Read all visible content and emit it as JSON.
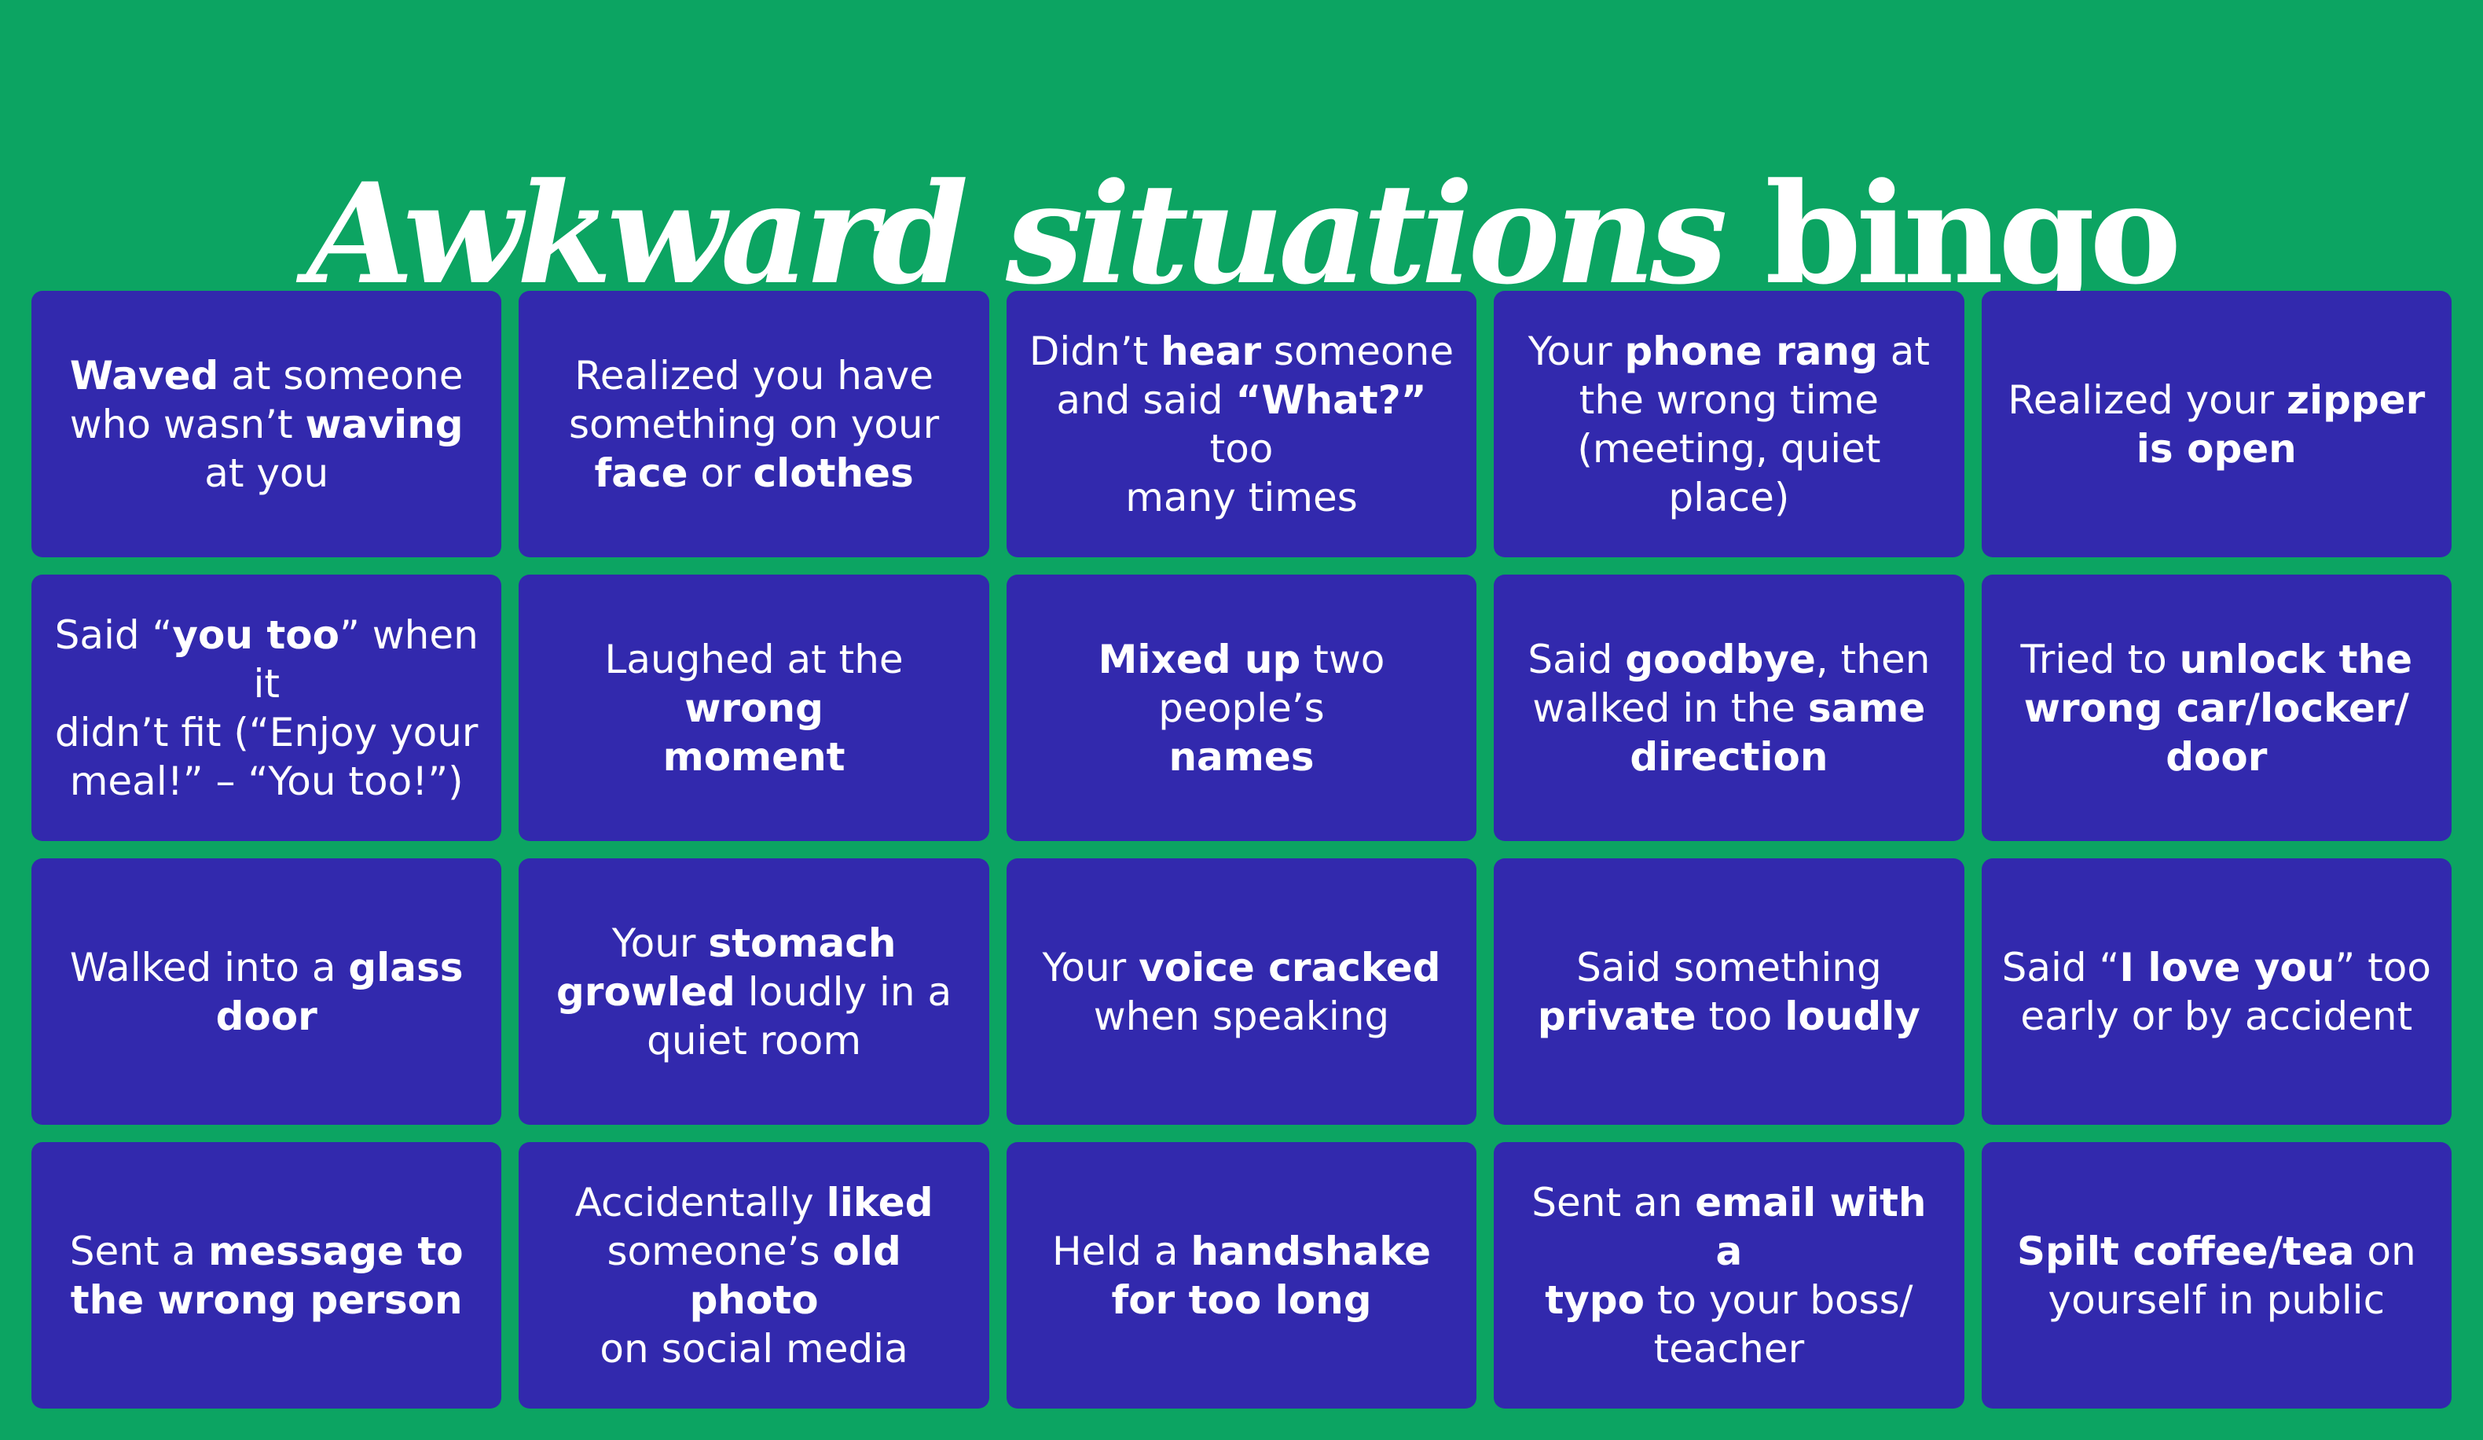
{
  "title": {
    "italic": "Awkward situations",
    "normal": "bingo"
  },
  "colors": {
    "background": "#0ca462",
    "tile": "#3229ad",
    "text": "#ffffff"
  },
  "tiles": [
    [
      [
        {
          "t": "Waved",
          "b": true
        },
        {
          "t": " at someone "
        },
        {
          "br": true
        },
        {
          "t": "who wasn’t "
        },
        {
          "t": "waving",
          "b": true
        },
        {
          "br": true
        },
        {
          "t": "at you"
        }
      ],
      [
        {
          "t": "Realized you have "
        },
        {
          "br": true
        },
        {
          "t": "something on your "
        },
        {
          "br": true
        },
        {
          "t": "face",
          "b": true
        },
        {
          "t": " or "
        },
        {
          "t": "clothes",
          "b": true
        }
      ],
      [
        {
          "t": "Didn’t "
        },
        {
          "t": "hear",
          "b": true
        },
        {
          "t": " someone "
        },
        {
          "br": true
        },
        {
          "t": "and said "
        },
        {
          "t": "“What?”",
          "b": true
        },
        {
          "t": " too "
        },
        {
          "br": true
        },
        {
          "t": "many times"
        }
      ],
      [
        {
          "t": "Your "
        },
        {
          "t": "phone rang",
          "b": true
        },
        {
          "t": " at "
        },
        {
          "br": true
        },
        {
          "t": "the wrong time "
        },
        {
          "br": true
        },
        {
          "t": "(meeting, quiet place)"
        }
      ],
      [
        {
          "t": "Realized your "
        },
        {
          "t": "zipper",
          "b": true
        },
        {
          "br": true
        },
        {
          "t": "is open",
          "b": true
        }
      ]
    ],
    [
      [
        {
          "t": "Said “"
        },
        {
          "t": "you too",
          "b": true
        },
        {
          "t": "” when it "
        },
        {
          "br": true
        },
        {
          "t": "didn’t fit (“Enjoy your "
        },
        {
          "br": true
        },
        {
          "t": "meal!” – “You too!”)"
        }
      ],
      [
        {
          "t": "Laughed at the "
        },
        {
          "t": "wrong",
          "b": true
        },
        {
          "br": true
        },
        {
          "t": "moment",
          "b": true
        }
      ],
      [
        {
          "t": "Mixed up",
          "b": true
        },
        {
          "t": " two people’s "
        },
        {
          "br": true
        },
        {
          "t": "names",
          "b": true
        }
      ],
      [
        {
          "t": "Said "
        },
        {
          "t": "goodbye",
          "b": true
        },
        {
          "t": ", then "
        },
        {
          "br": true
        },
        {
          "t": "walked in the "
        },
        {
          "t": "same",
          "b": true
        },
        {
          "br": true
        },
        {
          "t": "direction",
          "b": true
        }
      ],
      [
        {
          "t": "Tried to "
        },
        {
          "t": "unlock the",
          "b": true
        },
        {
          "br": true
        },
        {
          "t": "wrong car/locker/",
          "b": true
        },
        {
          "br": true
        },
        {
          "t": "door",
          "b": true
        }
      ]
    ],
    [
      [
        {
          "t": "Walked into a "
        },
        {
          "t": "glass",
          "b": true
        },
        {
          "br": true
        },
        {
          "t": "door",
          "b": true
        }
      ],
      [
        {
          "t": "Your "
        },
        {
          "t": "stomach",
          "b": true
        },
        {
          "br": true
        },
        {
          "t": "growled",
          "b": true
        },
        {
          "t": " loudly in a "
        },
        {
          "br": true
        },
        {
          "t": "quiet room"
        }
      ],
      [
        {
          "t": "Your "
        },
        {
          "t": "voice cracked",
          "b": true
        },
        {
          "br": true
        },
        {
          "t": "when speaking"
        }
      ],
      [
        {
          "t": "Said something "
        },
        {
          "br": true
        },
        {
          "t": "private",
          "b": true
        },
        {
          "t": " too "
        },
        {
          "t": "loudly",
          "b": true
        }
      ],
      [
        {
          "t": "Said “"
        },
        {
          "t": "I love you",
          "b": true
        },
        {
          "t": "” too "
        },
        {
          "br": true
        },
        {
          "t": "early or by accident"
        }
      ]
    ],
    [
      [
        {
          "t": "Sent a "
        },
        {
          "t": "message to",
          "b": true
        },
        {
          "br": true
        },
        {
          "t": "the wrong person",
          "b": true
        }
      ],
      [
        {
          "t": "Accidentally "
        },
        {
          "t": "liked",
          "b": true
        },
        {
          "br": true
        },
        {
          "t": "someone’s "
        },
        {
          "t": "old photo",
          "b": true
        },
        {
          "br": true
        },
        {
          "t": "on social media"
        }
      ],
      [
        {
          "t": "Held a "
        },
        {
          "t": "handshake",
          "b": true
        },
        {
          "br": true
        },
        {
          "t": "for too long",
          "b": true
        }
      ],
      [
        {
          "t": "Sent an "
        },
        {
          "t": "email with a",
          "b": true
        },
        {
          "br": true
        },
        {
          "t": "typo",
          "b": true
        },
        {
          "t": " to your boss/"
        },
        {
          "br": true
        },
        {
          "t": "teacher"
        }
      ],
      [
        {
          "t": "Spilt coffee/tea",
          "b": true
        },
        {
          "t": " on "
        },
        {
          "br": true
        },
        {
          "t": "yourself in public"
        }
      ]
    ]
  ]
}
